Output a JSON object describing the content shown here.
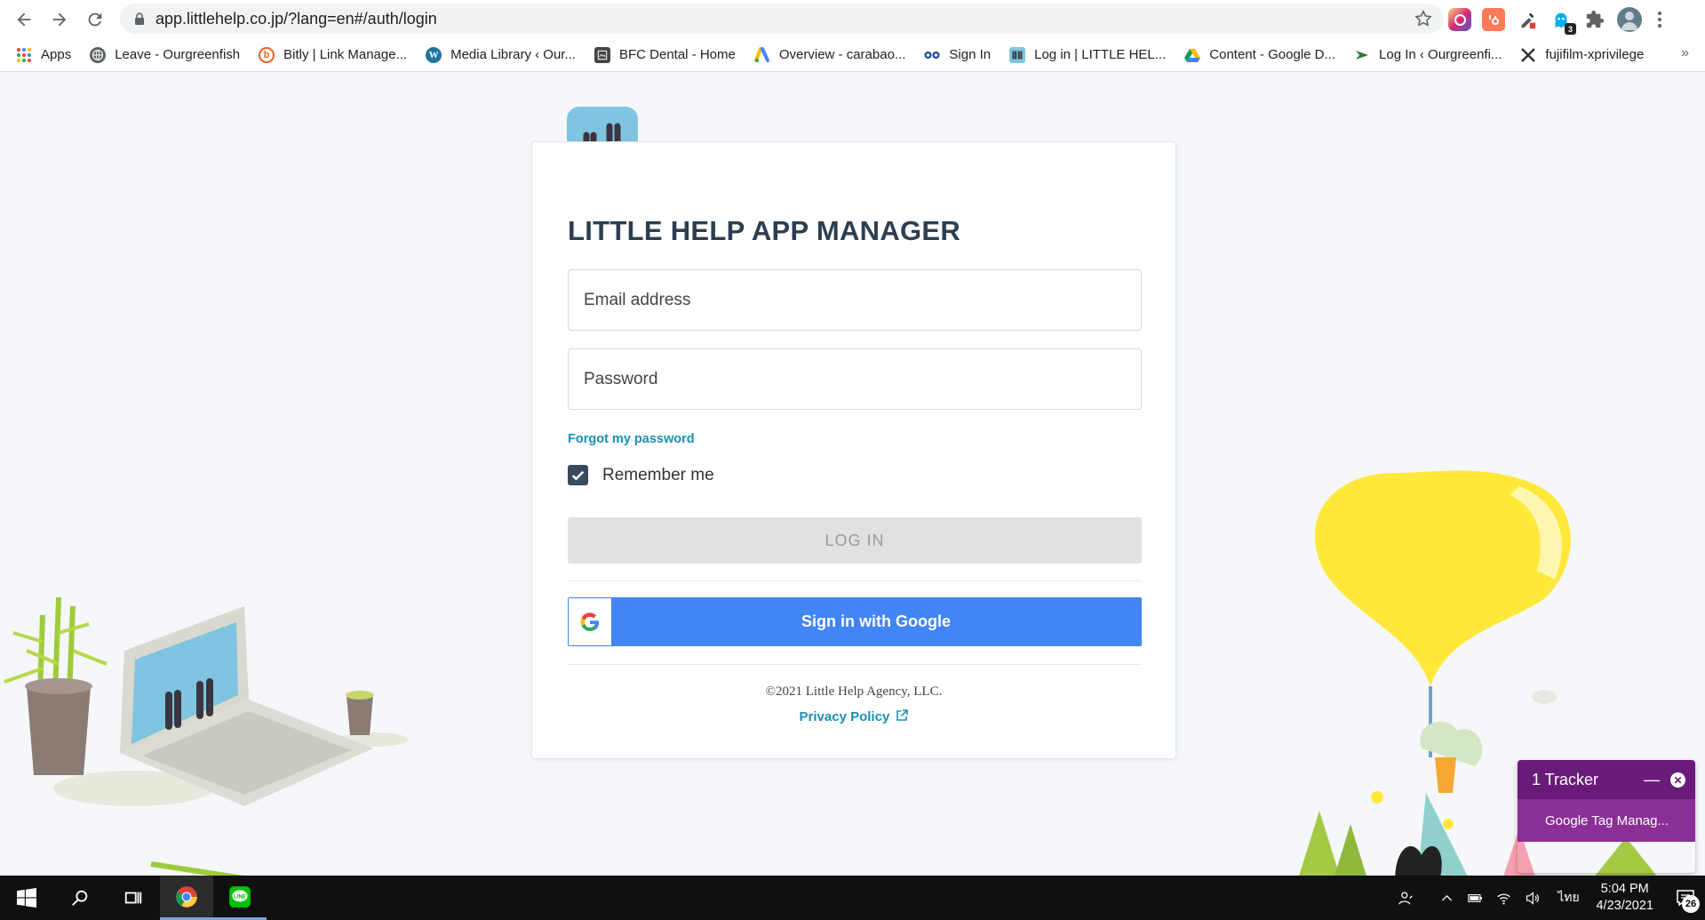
{
  "browser": {
    "url": "app.littlehelp.co.jp/?lang=en#/auth/login",
    "extensions": [
      {
        "name": "instagram-ext-icon",
        "color": "#c13584",
        "label": ""
      },
      {
        "name": "hubspot-ext-icon",
        "color": "#ff7a59",
        "label": ""
      },
      {
        "name": "eyedropper-ext-icon",
        "color": "#444444",
        "label": ""
      },
      {
        "name": "ghostery-ext-icon",
        "color": "#00aef0",
        "label": "",
        "badge": "3"
      },
      {
        "name": "puzzle-ext-icon",
        "color": "#5f6368",
        "label": ""
      },
      {
        "name": "profile-avatar-icon",
        "color": "#607d8b",
        "label": ""
      }
    ],
    "bookmarks": [
      {
        "name": "bookmark-apps",
        "label": "Apps",
        "icon": "apps-grid-icon",
        "color": "#4285f4"
      },
      {
        "name": "bookmark-leave",
        "label": "Leave - Ourgreenfish",
        "icon": "globe-icon",
        "color": "#5f6368"
      },
      {
        "name": "bookmark-bitly",
        "label": "Bitly | Link Manage...",
        "icon": "bitly-icon",
        "color": "#ee6123"
      },
      {
        "name": "bookmark-media-library",
        "label": "Media Library ‹ Our...",
        "icon": "wordpress-icon",
        "color": "#21759b"
      },
      {
        "name": "bookmark-bfc-dental",
        "label": "BFC Dental - Home",
        "icon": "page-icon",
        "color": "#444444"
      },
      {
        "name": "bookmark-overview",
        "label": "Overview - carabao...",
        "icon": "google-ads-icon",
        "color": "#fbbc04"
      },
      {
        "name": "bookmark-sign-in",
        "label": "Sign In",
        "icon": "sign-in-icon",
        "color": "#1a4a9a"
      },
      {
        "name": "bookmark-little-help",
        "label": "Log in | LITTLE HEL...",
        "icon": "little-help-icon",
        "color": "#7fc4e0"
      },
      {
        "name": "bookmark-google-drive",
        "label": "Content - Google D...",
        "icon": "google-drive-icon",
        "color": "#0f9d58"
      },
      {
        "name": "bookmark-log-in",
        "label": "Log In ‹ Ourgreenfi...",
        "icon": "ourgreenfish-icon",
        "color": "#2e7d32"
      },
      {
        "name": "bookmark-fujifilm",
        "label": "fujifilm-xprivilege",
        "icon": "x-icon",
        "color": "#333333"
      }
    ],
    "bookmarks_more": "»"
  },
  "login": {
    "title": "LITTLE HELP APP MANAGER",
    "email_placeholder": "Email address",
    "password_placeholder": "Password",
    "forgot_password": "Forgot my password",
    "remember_me": "Remember me",
    "remember_checked": true,
    "login_button": "LOG IN",
    "google_button": "Sign in with Google",
    "copyright": "©2021 Little Help Agency, LLC.",
    "privacy_policy": "Privacy Policy"
  },
  "tracker": {
    "title": "1 Tracker",
    "item": "Google Tag Manag..."
  },
  "taskbar": {
    "time": "5:04 PM",
    "date": "4/23/2021",
    "language": "ไทย",
    "notifications": "26"
  }
}
